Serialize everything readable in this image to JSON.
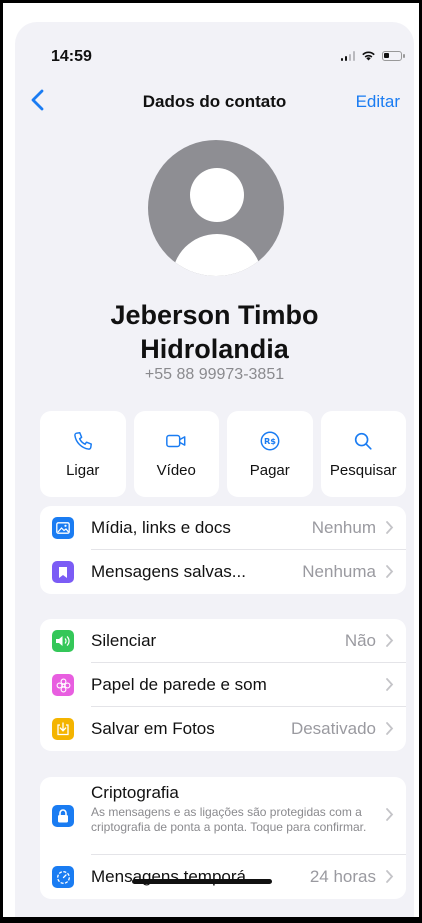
{
  "status": {
    "time": "14:59"
  },
  "nav": {
    "title": "Dados do contato",
    "edit": "Editar"
  },
  "contact": {
    "name_line1": "Jeberson Timbo",
    "name_line2": "Hidrolandia",
    "phone": "+55 88 99973-3851"
  },
  "actions": [
    {
      "label": "Ligar",
      "icon": "phone-icon"
    },
    {
      "label": "Vídeo",
      "icon": "video-icon"
    },
    {
      "label": "Pagar",
      "icon": "real-currency-icon"
    },
    {
      "label": "Pesquisar",
      "icon": "search-icon"
    }
  ],
  "group1": [
    {
      "label": "Mídia, links e docs",
      "value": "Nenhum",
      "icon": "photo-icon",
      "color": "#1a7cf2"
    },
    {
      "label": "Mensagens salvas...",
      "value": "Nenhuma",
      "icon": "bookmark-icon",
      "color": "#7b5cf5"
    }
  ],
  "group2": [
    {
      "label": "Silenciar",
      "value": "Não",
      "icon": "speaker-icon",
      "color": "#34c759"
    },
    {
      "label": "Papel de parede e som",
      "value": "",
      "icon": "flower-icon",
      "color": "#e85ee0"
    },
    {
      "label": "Salvar em Fotos",
      "value": "Desativado",
      "icon": "download-icon",
      "color": "#f4b400"
    }
  ],
  "group3": {
    "crypto_title": "Criptografia",
    "crypto_desc": "As mensagens e as ligações são protegidas com a criptografia de ponta a ponta. Toque para confirmar.",
    "crypto_color": "#1a7cf2",
    "temp_label": "Mensagens temporá...",
    "temp_value": "24 horas",
    "temp_color": "#1a7cf2"
  }
}
